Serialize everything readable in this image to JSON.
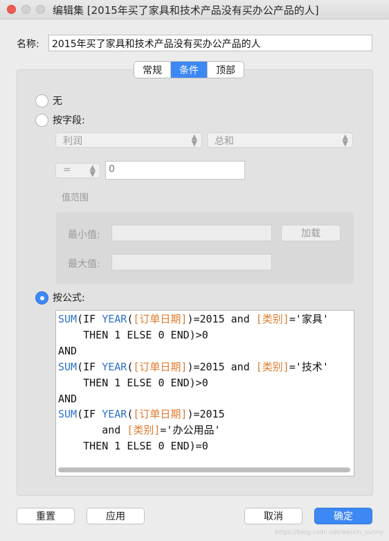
{
  "window": {
    "title": "编辑集 [2015年买了家具和技术产品没有买办公产品的人]"
  },
  "name_field": {
    "label": "名称:",
    "value": "2015年买了家具和技术产品没有买办公产品的人"
  },
  "tabs": [
    {
      "label": "常规",
      "active": false
    },
    {
      "label": "条件",
      "active": true
    },
    {
      "label": "顶部",
      "active": false
    }
  ],
  "condition": {
    "none_label": "无",
    "by_field_label": "按字段:",
    "field_select": "利润",
    "aggregation_select": "总和",
    "operator_select": "=",
    "value": "0",
    "value_range_label": "值范围",
    "min_label": "最小值:",
    "max_label": "最大值:",
    "load_button": "加载",
    "by_formula_label": "按公式:",
    "selected": "by_formula"
  },
  "formula": {
    "lines": [
      "SUM(IF YEAR([订单日期])=2015 and [类别]='家具'",
      "    THEN 1 ELSE 0 END)>0",
      "AND",
      "SUM(IF YEAR([订单日期])=2015 and [类别]='技术'",
      "    THEN 1 ELSE 0 END)>0",
      "AND",
      "SUM(IF YEAR([订单日期])=2015",
      "       and [类别]='办公用品'",
      "    THEN 1 ELSE 0 END)=0"
    ]
  },
  "buttons": {
    "reset": "重置",
    "apply": "应用",
    "cancel": "取消",
    "ok": "确定"
  },
  "watermark": "https://blog.csdn.net/weixin_sunny",
  "colors": {
    "accent": "#3d88f5",
    "keyword": "#2c72c7",
    "field_ref": "#e07a2e",
    "close": "#ee5b51"
  }
}
